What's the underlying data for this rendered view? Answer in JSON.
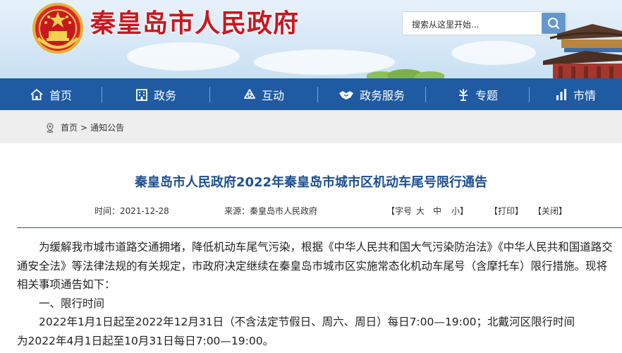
{
  "header": {
    "site_title": "秦皇岛市人民政府",
    "search_placeholder": "搜索从这里开始..."
  },
  "nav": [
    {
      "label": "首页",
      "icon": "home-icon"
    },
    {
      "label": "政务",
      "icon": "building-icon"
    },
    {
      "label": "互动",
      "icon": "chat-icon"
    },
    {
      "label": "政务服务",
      "icon": "handshake-icon"
    },
    {
      "label": "专题",
      "icon": "topic-icon"
    },
    {
      "label": "市情",
      "icon": "stats-icon"
    }
  ],
  "breadcrumb": {
    "home": "首页",
    "separator": ">",
    "current": "通知公告"
  },
  "article": {
    "title": "秦皇岛市人民政府2022年秦皇岛市城市区机动车尾号限行通告",
    "time": "时间：2021-12-28",
    "source": "来源：秦皇岛市人民政府",
    "font_size_label": "【字号",
    "font_big": "大",
    "font_mid": "中",
    "font_small": "小】",
    "print": "【打印】",
    "close": "【关闭】",
    "paragraphs": [
      "为缓解我市城市道路交通拥堵，降低机动车尾气污染，根据《中华人民共和国大气污染防治法》《中华人民共和国道路交通安全法》等法律法规的有关规定，市政府决定继续在秦皇岛市城市区实施常态化机动车尾号（含摩托车）限行措施。现将相关事项通告如下：",
      "一、限行时间",
      "2022年1月1日起至2022年12月31日（不含法定节假日、周六、周日）每日7:00—19:00；北戴河区限行时间",
      "为2022年4月1日起至10月31日每日7:00—19:00。"
    ]
  },
  "colors": {
    "nav_bg": "#1f5ba3",
    "title_red": "#c8181e",
    "article_title": "#1d4f8f"
  }
}
